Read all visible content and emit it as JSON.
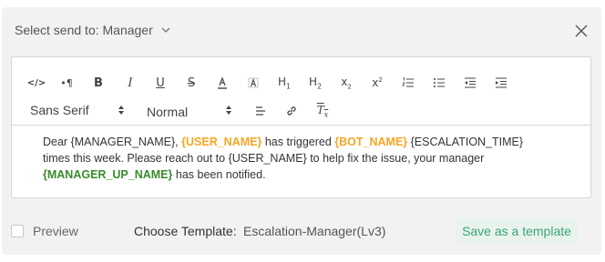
{
  "header": {
    "send_to_label": "Select send to: Manager",
    "icons": {
      "dropdown": "chevron-down-icon",
      "close": "close-icon"
    }
  },
  "toolbar": {
    "font_family": "Sans Serif",
    "font_size": "Normal",
    "buttons": [
      "code-view",
      "paragraph",
      "bold",
      "italic",
      "underline",
      "strikethrough",
      "font-color",
      "background-color",
      "heading-1",
      "heading-2",
      "subscript",
      "superscript",
      "ordered-list",
      "bullet-list",
      "outdent",
      "indent",
      "align",
      "link",
      "clear-formatting"
    ]
  },
  "content": {
    "p1": "Dear {MANAGER_NAME}, ",
    "t1": "{USER_NAME}",
    "p2": " has triggered ",
    "t2": "{BOT_NAME}",
    "p3": " {ESCALATION_TIME} times this week. Please reach out to {USER_NAME} to help fix the issue, your manager ",
    "t3": "{MANAGER_UP_NAME}",
    "p4": " has been notified."
  },
  "footer": {
    "preview_label": "Preview",
    "preview_checked": false,
    "template_label": "Choose Template:",
    "template_value": "Escalation-Manager(Lv3)",
    "save_label": "Save as a template"
  },
  "colors": {
    "accent_green": "#3aa37a",
    "token_orange": "#f5a623",
    "token_green": "#3a8a2a",
    "dialog_bg": "#f2f2f2"
  }
}
